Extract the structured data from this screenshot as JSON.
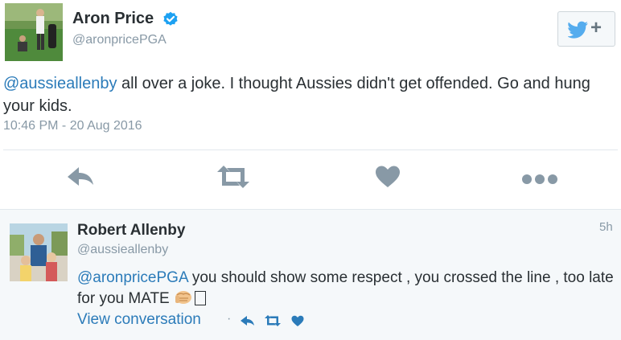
{
  "tweet": {
    "author_name": "Aron Price",
    "author_handle": "@aronpricePGA",
    "mention": "@aussieallenby",
    "text_rest": " all over a joke. I thought Aussies didn't get offended. Go and hung your kids.",
    "timestamp": "10:46 PM - 20 Aug 2016",
    "icons": [
      "verified-badge-icon",
      "twitter-bird-icon",
      "reply-icon",
      "retweet-icon",
      "like-icon",
      "more-icon"
    ],
    "follow_plus": "+"
  },
  "reply": {
    "author_name": "Robert Allenby",
    "author_handle": "@aussieallenby",
    "time": "5h",
    "mention": "@aronpricePGA",
    "text_rest": " you should show some respect , you crossed the line , too late for you MATE ",
    "view_conversation": "View conversation",
    "separator": "·",
    "icons": [
      "fist-emoji-icon",
      "reply-icon",
      "retweet-icon",
      "like-icon"
    ]
  },
  "colors": {
    "link": "#2b7bb9",
    "muted": "#8899a6",
    "text": "#292f33",
    "verified": "#1da1f2",
    "action_icon": "#8899a6",
    "reply_bg": "#f5f8fa"
  }
}
